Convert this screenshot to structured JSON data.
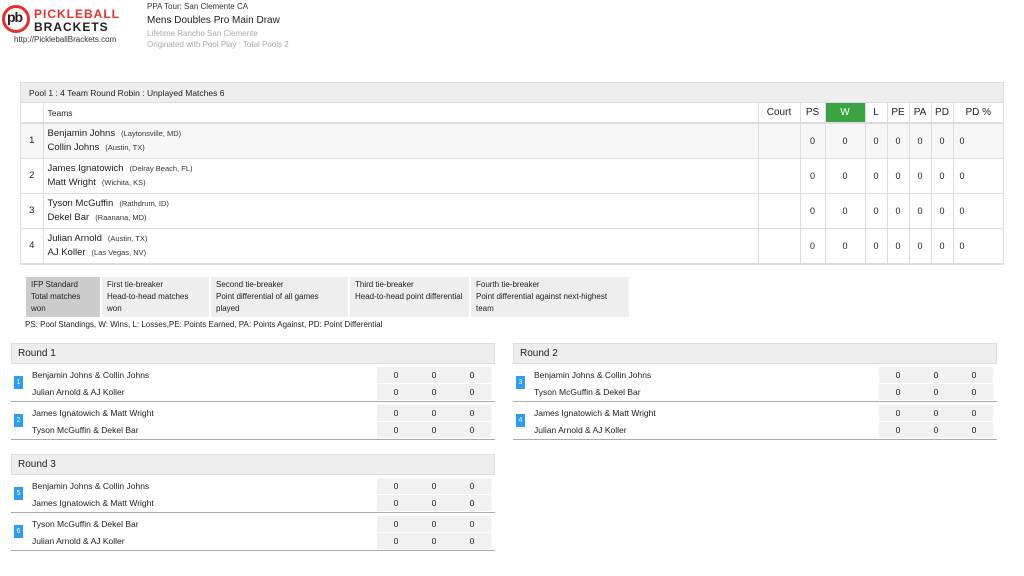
{
  "header": {
    "logo_line1": "PICKLEBALL",
    "logo_line2": "BRACKETS",
    "logo_mark": "pb",
    "site_url": "http://PickleballBrackets.com",
    "tour": "PPA Tour: San Clemente CA",
    "event": "Mens Doubles Pro Main Draw",
    "venue": "Lifetime Rancho San Clemente",
    "origin": "Originated with Pool Play : Total Pools 2"
  },
  "pool": {
    "title": "Pool 1 : 4 Team Round Robin : Unplayed Matches 6",
    "columns": [
      "Teams",
      "Court",
      "PS",
      "W",
      "L",
      "PE",
      "PA",
      "PD",
      "PD %"
    ],
    "rows": [
      {
        "no": "1",
        "p1": "Benjamin Johns",
        "p1_loc": "(Laytonsville, MD)",
        "p2": "Collin Johns",
        "p2_loc": "(Austin, TX)",
        "court": "",
        "ps": "0",
        "w": "0",
        "l": "0",
        "pe": "0",
        "pa": "0",
        "pd": "0",
        "pdp": "0"
      },
      {
        "no": "2",
        "p1": "James Ignatowich",
        "p1_loc": "(Delray Beach, FL)",
        "p2": "Matt Wright",
        "p2_loc": "(Wichita, KS)",
        "court": "",
        "ps": "0",
        "w": "0",
        "l": "0",
        "pe": "0",
        "pa": "0",
        "pd": "0",
        "pdp": "0"
      },
      {
        "no": "3",
        "p1": "Tyson McGuffin",
        "p1_loc": "(Rathdrum, ID)",
        "p2": "Dekel Bar",
        "p2_loc": "(Raanana, MD)",
        "court": "",
        "ps": "0",
        "w": "0",
        "l": "0",
        "pe": "0",
        "pa": "0",
        "pd": "0",
        "pdp": "0"
      },
      {
        "no": "4",
        "p1": "Julian Arnold",
        "p1_loc": "(Austin, TX)",
        "p2": "AJ Koller",
        "p2_loc": "(Las Vegas, NV)",
        "court": "",
        "ps": "0",
        "w": "0",
        "l": "0",
        "pe": "0",
        "pa": "0",
        "pd": "0",
        "pdp": "0"
      }
    ]
  },
  "tiebreakers": [
    {
      "title": "IFP Standard",
      "desc": "Total matches won"
    },
    {
      "title": "First tie-breaker",
      "desc": "Head-to-head matches won"
    },
    {
      "title": "Second tie-breaker",
      "desc": "Point differential of all games played"
    },
    {
      "title": "Third tie-breaker",
      "desc": "Head-to-head point differential"
    },
    {
      "title": "Fourth tie-breaker",
      "desc": "Point differential against next-highest team"
    }
  ],
  "legend": "PS: Pool Standings, W: Wins, L: Losses,PE: Points Earned, PA: Points Against, PD: Point Differential",
  "rounds": [
    {
      "title": "Round 1",
      "matches": [
        {
          "no": "1",
          "t1": "Benjamin Johns & Collin Johns",
          "t2": "Julian Arnold & AJ Koller",
          "s1": [
            "0",
            "0",
            "0"
          ],
          "s2": [
            "0",
            "0",
            "0"
          ]
        },
        {
          "no": "2",
          "t1": "James Ignatowich & Matt Wright",
          "t2": "Tyson McGuffin & Dekel Bar",
          "s1": [
            "0",
            "0",
            "0"
          ],
          "s2": [
            "0",
            "0",
            "0"
          ]
        }
      ]
    },
    {
      "title": "Round 2",
      "matches": [
        {
          "no": "3",
          "t1": "Benjamin Johns & Collin Johns",
          "t2": "Tyson McGuffin & Dekel Bar",
          "s1": [
            "0",
            "0",
            "0"
          ],
          "s2": [
            "0",
            "0",
            "0"
          ]
        },
        {
          "no": "4",
          "t1": "James Ignatowich & Matt Wright",
          "t2": "Julian Arnold & AJ Koller",
          "s1": [
            "0",
            "0",
            "0"
          ],
          "s2": [
            "0",
            "0",
            "0"
          ]
        }
      ]
    },
    {
      "title": "Round 3",
      "matches": [
        {
          "no": "5",
          "t1": "Benjamin Johns & Collin Johns",
          "t2": "James Ignatowich & Matt Wright",
          "s1": [
            "0",
            "0",
            "0"
          ],
          "s2": [
            "0",
            "0",
            "0"
          ]
        },
        {
          "no": "6",
          "t1": "Tyson McGuffin & Dekel Bar",
          "t2": "Julian Arnold & AJ Koller",
          "s1": [
            "0",
            "0",
            "0"
          ],
          "s2": [
            "0",
            "0",
            "0"
          ]
        }
      ]
    }
  ],
  "colors": {
    "brand_red": "#e4312b",
    "win_green": "#3aa443",
    "match_blue": "#2a9df4"
  }
}
